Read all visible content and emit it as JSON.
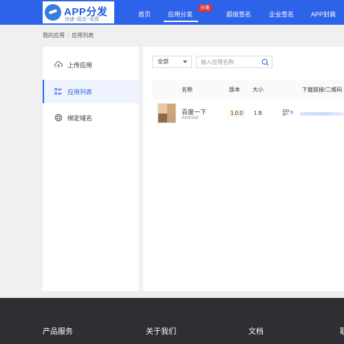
{
  "logo": {
    "title": "APP分发",
    "subtitle": "快速~稳定~免费"
  },
  "nav": [
    {
      "label": "首页"
    },
    {
      "label": "应用分发",
      "badge": "分发",
      "active": true
    },
    {
      "label": "超级签名"
    },
    {
      "label": "企业签名"
    },
    {
      "label": "APP封装"
    }
  ],
  "breadcrumb": {
    "items": [
      "我的应用",
      "应用列表"
    ],
    "separator": "/"
  },
  "sidebar": {
    "items": [
      {
        "label": "上传应用",
        "icon": "upload-cloud-icon"
      },
      {
        "label": "应用列表",
        "icon": "list-icon",
        "active": true
      },
      {
        "label": "绑定域名",
        "icon": "globe-icon"
      }
    ]
  },
  "filter": {
    "selected": "全部"
  },
  "search": {
    "placeholder": "输入应用名称",
    "value": ""
  },
  "table": {
    "columns": [
      "名称",
      "版本",
      "大小",
      "下载链接/二维码"
    ],
    "rows": [
      {
        "name": "百度一下",
        "platform": "Android",
        "version": "1.0.0",
        "size": "1 B",
        "link_prefix": "h"
      }
    ]
  },
  "footer": {
    "columns": [
      "产品服务",
      "关于我们",
      "文档",
      "联"
    ]
  },
  "colors": {
    "primary": "#2d63e9",
    "header_bg": "#2d63e9",
    "footer_bg": "#2e2e33",
    "badge_red": "#e5312f",
    "page_bg": "#f0f0f0"
  }
}
